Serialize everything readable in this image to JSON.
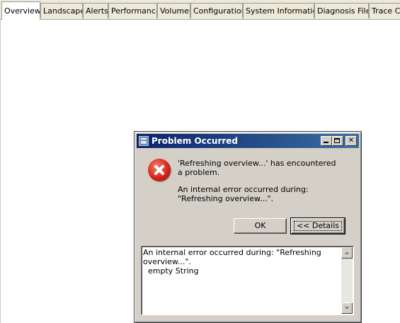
{
  "tabs": [
    {
      "label": "Overview",
      "active": true
    },
    {
      "label": "Landscape"
    },
    {
      "label": "Alerts"
    },
    {
      "label": "Performance"
    },
    {
      "label": "Volumes"
    },
    {
      "label": "Configuration"
    },
    {
      "label": "System Information"
    },
    {
      "label": "Diagnosis Files"
    },
    {
      "label": "Trace Co"
    }
  ],
  "dialog": {
    "title": "Problem Occurred",
    "message": "'Refreshing overview...' has encountered a problem.",
    "detail_message": "An internal error occurred during: \"Refreshing overview...\".",
    "ok_label": "OK",
    "details_label": "<< Details",
    "details_text": "An internal error occurred during: \"Refreshing overview...\".\n  empty String",
    "icon": "error-icon"
  }
}
